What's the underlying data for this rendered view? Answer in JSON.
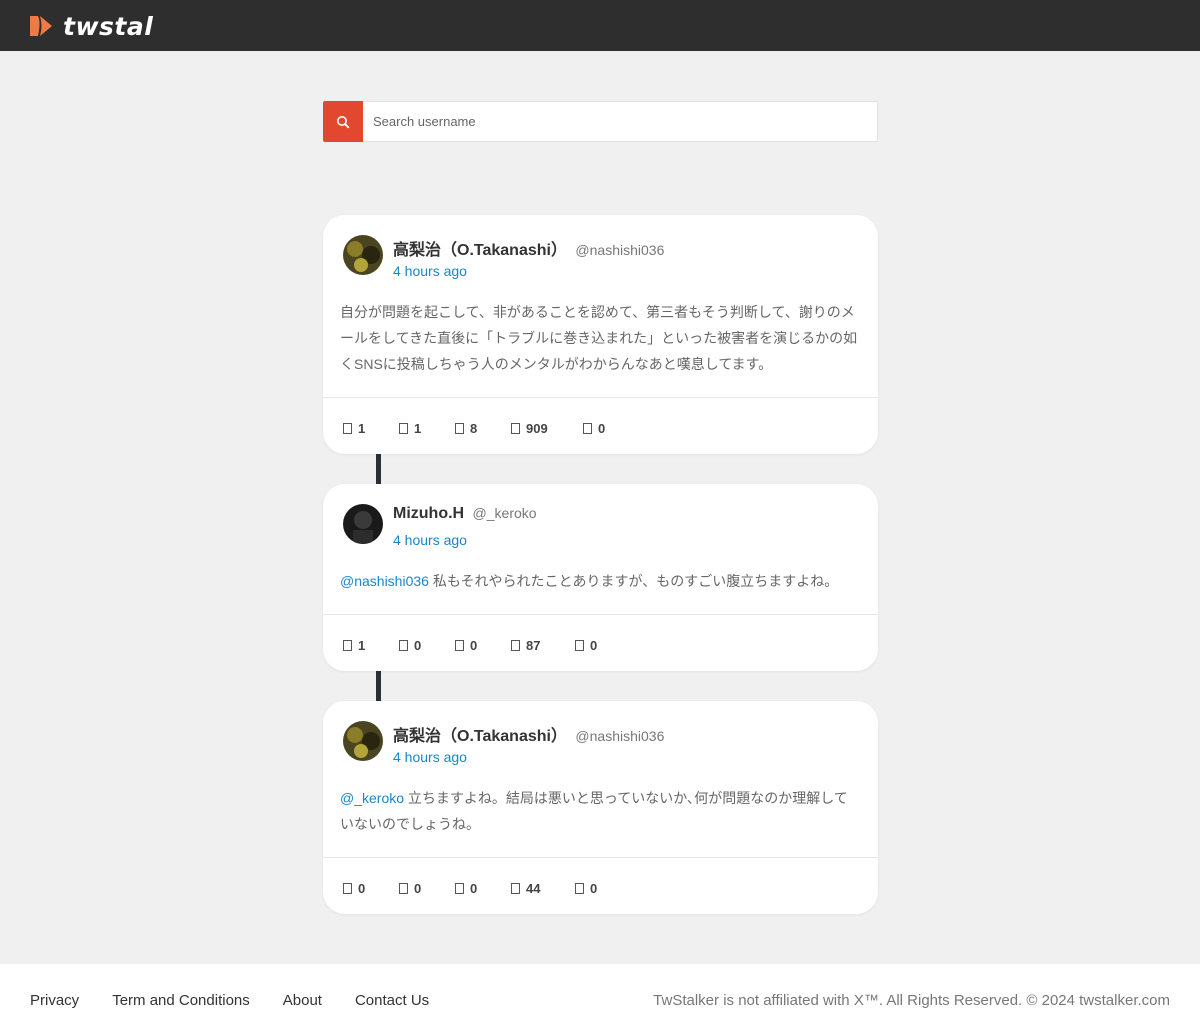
{
  "header": {
    "brand": "twstalker",
    "colors": {
      "bar": "#2e2e2e",
      "accent": "#e2472f"
    }
  },
  "search": {
    "placeholder": "Search username",
    "icon": "search-icon"
  },
  "tweets": [
    {
      "name": "高梨治（O.Takanashi）",
      "handle": "@nashishi036",
      "time": "4 hours ago",
      "mention": "",
      "text": "自分が問題を起こして、非があることを認めて、第三者もそう判断して、謝りのメールをしてきた直後に「トラブルに巻き込まれた」といった被害者を演じるかの如くSNSに投稿しちゃう人のメンタルがわからんなあと嘆息してます。",
      "stats": {
        "replies": "1",
        "retweets": "1",
        "likes": "8",
        "views": "909",
        "bookmarks": "0"
      }
    },
    {
      "name": "Mizuho.H",
      "handle": "@_keroko",
      "time": "4 hours ago",
      "mention": "@nashishi036",
      "text": " 私もそれやられたことありますが、ものすごい腹立ちますよね。",
      "stats": {
        "replies": "1",
        "retweets": "0",
        "likes": "0",
        "views": "87",
        "bookmarks": "0"
      }
    },
    {
      "name": "高梨治（O.Takanashi）",
      "handle": "@nashishi036",
      "time": "4 hours ago",
      "mention": "@_keroko",
      "text": " 立ちますよね。結局は悪いと思っていないか､何が問題なのか理解していないのでしょうね。",
      "stats": {
        "replies": "0",
        "retweets": "0",
        "likes": "0",
        "views": "44",
        "bookmarks": "0"
      }
    }
  ],
  "stat_icons": [
    "reply-icon",
    "retweet-icon",
    "like-icon",
    "views-icon",
    "bookmark-icon"
  ],
  "footer": {
    "links": [
      "Privacy",
      "Term and Conditions",
      "About",
      "Contact Us"
    ],
    "copyright": "TwStalker is not affiliated with X™. All Rights Reserved. © 2024 twstalker.com"
  }
}
